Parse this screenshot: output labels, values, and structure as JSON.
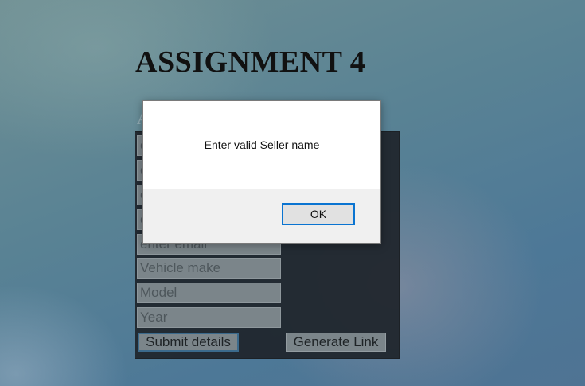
{
  "page": {
    "title": "ASSIGNMENT 4",
    "subheading_fragment": "A"
  },
  "form": {
    "fields": [
      {
        "placeholder": "e"
      },
      {
        "placeholder": "e"
      },
      {
        "placeholder": "e"
      },
      {
        "placeholder": "e"
      },
      {
        "placeholder": "enter email"
      },
      {
        "placeholder": "Vehicle make"
      },
      {
        "placeholder": "Model"
      },
      {
        "placeholder": "Year"
      }
    ],
    "submit_label": "Submit details",
    "generate_label": "Generate Link"
  },
  "dialog": {
    "message": "Enter valid Seller name",
    "ok_label": "OK"
  },
  "colors": {
    "panel_bg": "#1e242a",
    "field_bg": "#7b858a",
    "ok_border": "#0a74d1"
  }
}
